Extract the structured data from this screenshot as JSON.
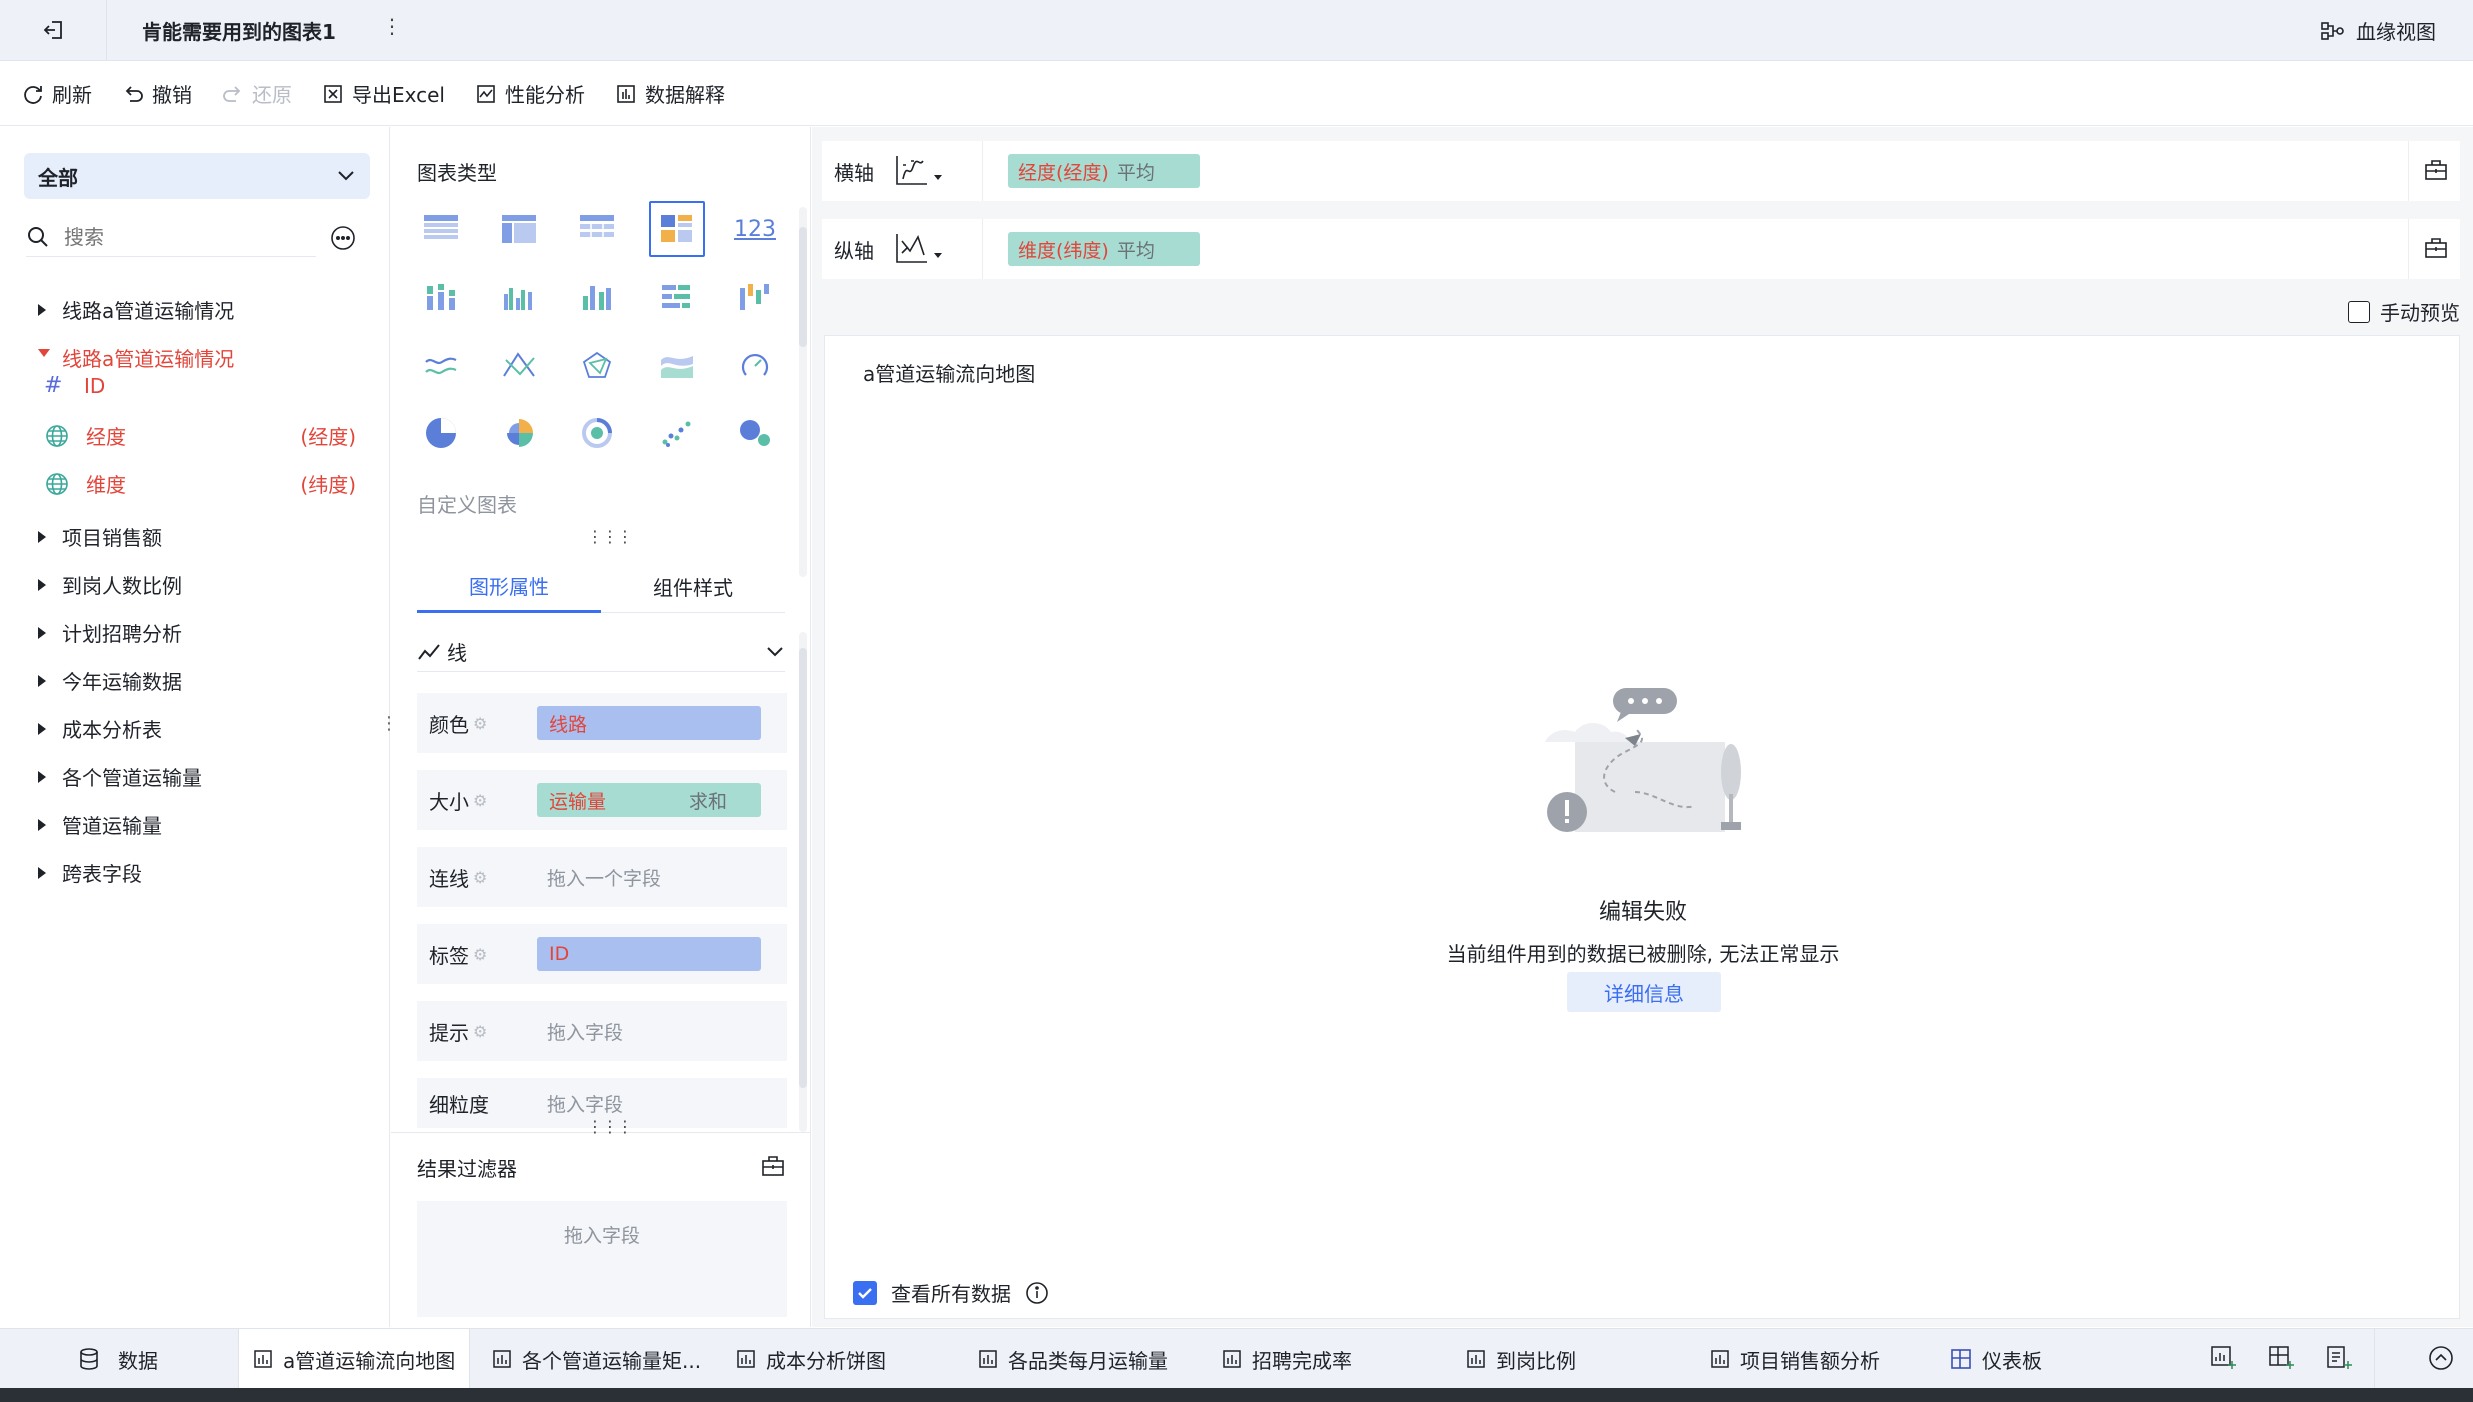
{
  "titlebar": {
    "title": "肯能需要用到的图表1",
    "lineage_label": "血缘视图"
  },
  "toolbar": {
    "refresh": "刷新",
    "undo": "撤销",
    "redo": "还原",
    "export_excel": "导出Excel",
    "perf": "性能分析",
    "explain": "数据解释"
  },
  "left": {
    "scope": "全部",
    "search_placeholder": "搜索",
    "tree": [
      {
        "label": "线路a管道运输情况",
        "expanded": false
      },
      {
        "label": "线路a管道运输情况",
        "expanded": true
      },
      {
        "label": "项目销售额"
      },
      {
        "label": "到岗人数比例"
      },
      {
        "label": "计划招聘分析"
      },
      {
        "label": "今年运输数据"
      },
      {
        "label": "成本分析表"
      },
      {
        "label": "各个管道运输量"
      },
      {
        "label": "管道运输量"
      },
      {
        "label": "跨表字段"
      }
    ],
    "fields": [
      {
        "name": "ID",
        "suffix": ""
      },
      {
        "name": "经度",
        "suffix": "(经度)"
      },
      {
        "name": "维度",
        "suffix": "(纬度)"
      }
    ]
  },
  "middle": {
    "chart_type_title": "图表类型",
    "custom_chart": "自定义图表",
    "tab_graphic": "图形属性",
    "tab_style": "组件样式",
    "mark_type": "线",
    "props": {
      "color": {
        "label": "颜色",
        "field": "线路"
      },
      "size": {
        "label": "大小",
        "field": "运输量",
        "agg": "求和"
      },
      "line": {
        "label": "连线",
        "placeholder": "拖入一个字段"
      },
      "label": {
        "label": "标签",
        "field": "ID"
      },
      "tip": {
        "label": "提示",
        "placeholder": "拖入字段"
      },
      "granularity": {
        "label": "细粒度",
        "placeholder": "拖入字段"
      }
    },
    "filter_title": "结果过滤器",
    "filter_placeholder": "拖入字段"
  },
  "right": {
    "x_axis": {
      "label": "横轴",
      "field": "经度(经度)",
      "agg": "平均"
    },
    "y_axis": {
      "label": "纵轴",
      "field": "维度(纬度)",
      "agg": "平均"
    },
    "manual_preview": "手动预览",
    "chart_title": "a管道运输流向地图",
    "error_title": "编辑失败",
    "error_desc": "当前组件用到的数据已被删除, 无法正常显示",
    "detail_button": "详细信息",
    "view_all": "查看所有数据"
  },
  "bottom_tabs": [
    {
      "label": "数据"
    },
    {
      "label": "a管道运输流向地图"
    },
    {
      "label": "各个管道运输量矩..."
    },
    {
      "label": "成本分析饼图"
    },
    {
      "label": "各品类每月运输量"
    },
    {
      "label": "招聘完成率"
    },
    {
      "label": "到岗比例"
    },
    {
      "label": "项目销售额分析"
    },
    {
      "label": "仪表板"
    }
  ],
  "colors": {
    "accent": "#3a6ff2",
    "field_red": "#e2453a",
    "pill_blue": "#a9bff0",
    "pill_green": "#a6dcd2"
  }
}
